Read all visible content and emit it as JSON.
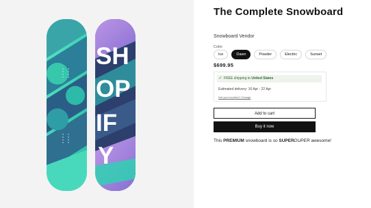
{
  "product": {
    "title": "The Complete Snowboard",
    "vendor": "Snowboard Vendor",
    "price": "$699.95",
    "description_prefix": "This ",
    "description_strong": "PREMIUM",
    "description_middle": " snowboard is so ",
    "description_super": "SUPER",
    "description_duper": "DUPER",
    "description_suffix": " awesome!"
  },
  "variant": {
    "label": "Color",
    "options": [
      "Ice",
      "Dawn",
      "Powder",
      "Electric",
      "Sunset"
    ],
    "selected": "Dawn"
  },
  "shipping": {
    "free_prefix": "FREE shipping to ",
    "destination": "United States",
    "delivery": "Estimated delivery: 16 Apr - 22 Apr",
    "change_link": "Not your location? Change"
  },
  "buttons": {
    "add_to_cart": "Add to cart",
    "buy_now": "Buy it now"
  },
  "board_graphic": {
    "letters": [
      "SH",
      "OP",
      "IF",
      "Y"
    ]
  },
  "colors": {
    "teal": "#2fd1b2",
    "navy": "#2c3f6d",
    "purple": "#a07ad6",
    "accent_dark": "#121212"
  }
}
